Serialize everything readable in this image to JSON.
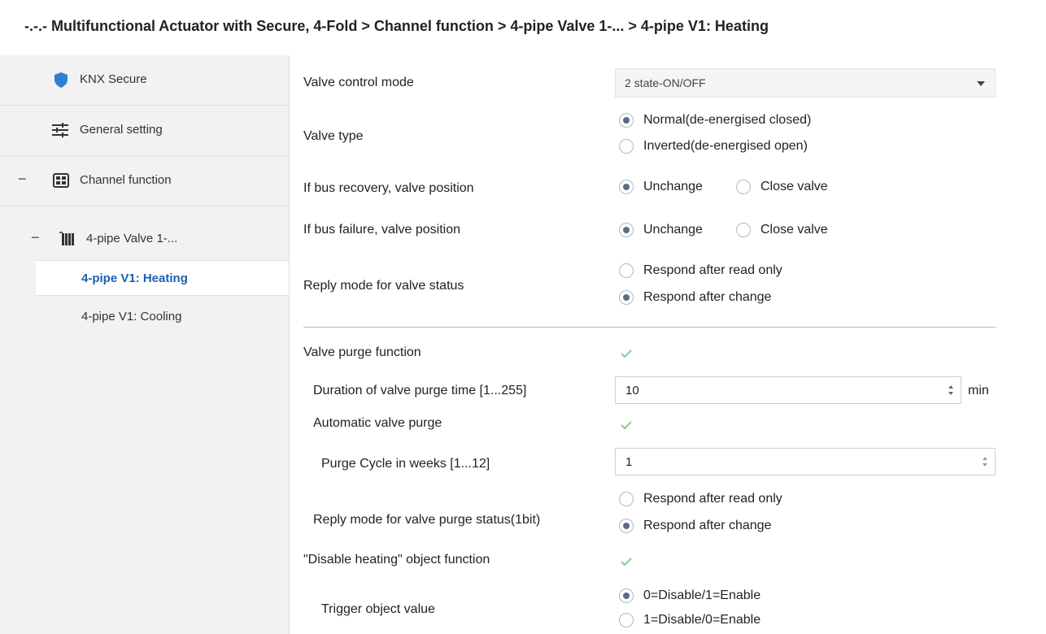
{
  "header": {
    "title": "-.-.- Multifunctional Actuator with Secure, 4-Fold > Channel function > 4-pipe Valve 1-... > 4-pipe V1: Heating"
  },
  "sidebar": {
    "items": [
      {
        "label": "KNX Secure",
        "icon": "shield-icon"
      },
      {
        "label": "General setting",
        "icon": "sliders-icon"
      },
      {
        "label": "Channel function",
        "icon": "grid-icon",
        "expand": "−"
      },
      {
        "label": "4-pipe Valve 1-...",
        "icon": "radiator-icon",
        "expand": "−"
      },
      {
        "label": "4-pipe V1: Heating",
        "active": true
      },
      {
        "label": "4-pipe V1: Cooling"
      }
    ]
  },
  "params": {
    "valve_control_mode": {
      "label": "Valve control mode",
      "value": "2 state-ON/OFF"
    },
    "valve_type": {
      "label": "Valve type",
      "options": [
        "Normal(de-energised closed)",
        "Inverted(de-energised open)"
      ],
      "selected": 0
    },
    "bus_recovery": {
      "label": "If bus recovery, valve position",
      "options": [
        "Unchange",
        "Close valve"
      ],
      "selected": 0
    },
    "bus_failure": {
      "label": "If bus failure, valve position",
      "options": [
        "Unchange",
        "Close valve"
      ],
      "selected": 0
    },
    "reply_mode": {
      "label": "Reply mode for valve status",
      "options": [
        "Respond after read only",
        "Respond after change"
      ],
      "selected": 1
    },
    "purge_function": {
      "label": "Valve purge function",
      "checked": true
    },
    "purge_duration": {
      "label": "Duration of valve purge time [1...255]",
      "value": "10",
      "unit": "min"
    },
    "auto_purge": {
      "label": "Automatic valve purge",
      "checked": true
    },
    "purge_cycle": {
      "label": "Purge Cycle in weeks [1...12]",
      "value": "1"
    },
    "purge_reply": {
      "label": "Reply mode for valve purge status(1bit)",
      "options": [
        "Respond after read only",
        "Respond after change"
      ],
      "selected": 1
    },
    "disable_heating": {
      "label": "\"Disable heating\" object function",
      "checked": true
    },
    "trigger_value": {
      "label": "Trigger object value",
      "options": [
        "0=Disable/1=Enable",
        "1=Disable/0=Enable"
      ],
      "selected": 0
    }
  },
  "colors": {
    "active_nav": "#1b5fb5",
    "checkmark": "#5cb85c",
    "shield": "#2f7fd6"
  }
}
